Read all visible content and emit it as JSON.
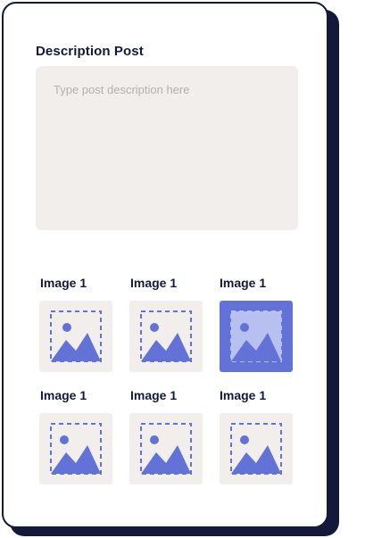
{
  "form": {
    "description_label": "Description Post",
    "description_placeholder": "Type post description here",
    "description_value": ""
  },
  "images": [
    {
      "label": "Image 1",
      "selected": false,
      "icon": "image-placeholder-icon"
    },
    {
      "label": "Image 1",
      "selected": false,
      "icon": "image-placeholder-icon"
    },
    {
      "label": "Image 1",
      "selected": true,
      "icon": "image-placeholder-icon"
    },
    {
      "label": "Image 1",
      "selected": false,
      "icon": "image-placeholder-icon"
    },
    {
      "label": "Image 1",
      "selected": false,
      "icon": "image-placeholder-icon"
    },
    {
      "label": "Image 1",
      "selected": false,
      "icon": "image-placeholder-icon"
    }
  ],
  "colors": {
    "accent": "#6272d6",
    "accent_light": "#b8c0f0",
    "panel": "#f1eeeb",
    "ink": "#14193a"
  }
}
